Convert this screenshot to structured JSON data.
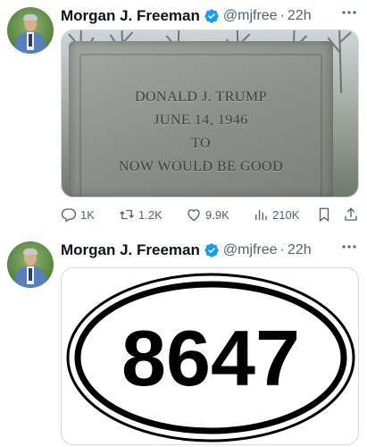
{
  "colors": {
    "verified": "#1d9bf0",
    "text": "#0f1419",
    "muted": "#536471",
    "border": "#cfd9de"
  },
  "tweets": [
    {
      "author": {
        "name": "Morgan J. Freeman",
        "handle": "@mjfree",
        "separator": "·",
        "time": "22h"
      },
      "icons": [
        "verified-badge-icon",
        "more-options-icon"
      ],
      "media": {
        "kind": "tombstone-photo",
        "lines": [
          "DONALD J. TRUMP",
          "JUNE 14, 1946",
          "TO",
          "NOW WOULD BE GOOD"
        ]
      },
      "actions": {
        "reply": "1K",
        "retweet": "1.2K",
        "like": "9.9K",
        "views": "210K"
      }
    },
    {
      "author": {
        "name": "Morgan J. Freeman",
        "handle": "@mjfree",
        "separator": "·",
        "time": "22h"
      },
      "icons": [
        "verified-badge-icon",
        "more-options-icon"
      ],
      "media": {
        "kind": "oval-sticker",
        "text": "8647"
      }
    }
  ]
}
